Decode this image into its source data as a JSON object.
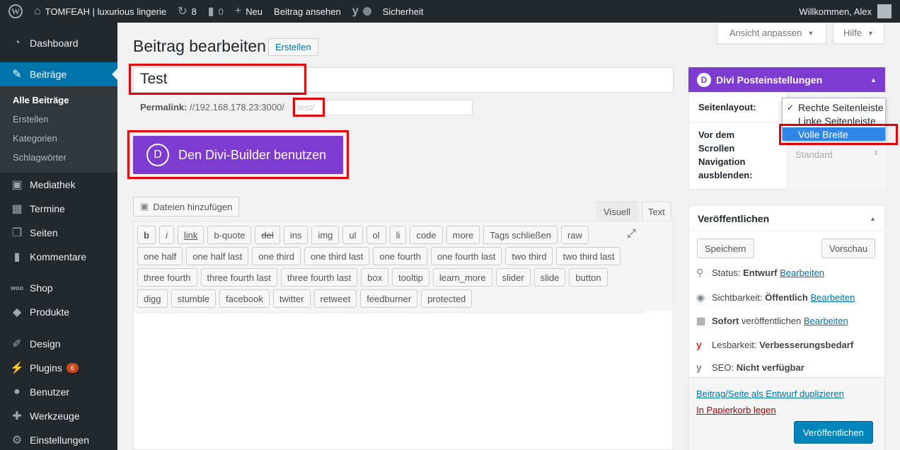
{
  "adminbar": {
    "site_name": "TOMFEAH | luxurious lingerie",
    "updates_count": "8",
    "comments_count": "0",
    "new_label": "Neu",
    "view_post_label": "Beitrag ansehen",
    "security_label": "Sicherheit",
    "welcome": "Willkommen, Alex"
  },
  "sidebar": {
    "items": [
      {
        "label": "Dashboard",
        "icon": "dashboard-icon"
      },
      {
        "label": "Beiträge",
        "icon": "pin-icon"
      },
      {
        "label": "Mediathek",
        "icon": "media-icon"
      },
      {
        "label": "Termine",
        "icon": "calendar-icon"
      },
      {
        "label": "Seiten",
        "icon": "pages-icon"
      },
      {
        "label": "Kommentare",
        "icon": "comment-icon"
      },
      {
        "label": "Shop",
        "icon": "woo-icon"
      },
      {
        "label": "Produkte",
        "icon": "products-icon"
      },
      {
        "label": "Design",
        "icon": "brush-icon"
      },
      {
        "label": "Plugins",
        "icon": "plugin-icon",
        "badge": "6"
      },
      {
        "label": "Benutzer",
        "icon": "user-icon"
      },
      {
        "label": "Werkzeuge",
        "icon": "wrench-icon"
      },
      {
        "label": "Einstellungen",
        "icon": "settings-icon"
      }
    ],
    "submenu": [
      "Alle Beiträge",
      "Erstellen",
      "Kategorien",
      "Schlagwörter"
    ]
  },
  "screen_options": {
    "label": "Ansicht anpassen",
    "help": "Hilfe"
  },
  "main": {
    "title": "Beitrag bearbeiten",
    "add_new": "Erstellen",
    "post_title": "Test",
    "permalink_label": "Permalink:",
    "permalink_url": "//192.168.178.23:3000/",
    "slug": "test/",
    "divi_button": "Den Divi-Builder benutzen",
    "media_button": "Dateien hinzufügen",
    "tab_visual": "Visuell",
    "tab_text": "Text",
    "quicktags": [
      "b",
      "i",
      "link",
      "b-quote",
      "del",
      "ins",
      "img",
      "ul",
      "ol",
      "li",
      "code",
      "more",
      "Tags schließen",
      "raw",
      "one half",
      "one half last",
      "one third",
      "one third last",
      "one fourth",
      "one fourth last",
      "two third",
      "two third last",
      "three fourth",
      "three fourth last",
      "three fourth last",
      "box",
      "tooltip",
      "learn_more",
      "slider",
      "slide",
      "button",
      "digg",
      "stumble",
      "facebook",
      "twitter",
      "retweet",
      "feedburner",
      "protected"
    ]
  },
  "divi_box": {
    "title": "Divi Posteinstellungen",
    "layout_label": "Seitenlayout:",
    "nav_label_1": "Vor dem",
    "nav_label_2": "Scrollen",
    "nav_label_3": "Navigation",
    "nav_label_4": "ausblenden:",
    "nav_value": "Standard",
    "layout_options": [
      "Rechte Seitenleiste",
      "Linke Seitenleiste",
      "Volle Breite"
    ]
  },
  "publish_box": {
    "title": "Veröffentlichen",
    "save": "Speichern",
    "preview": "Vorschau",
    "status_label": "Status:",
    "status_value": "Entwurf",
    "visibility_label": "Sichtbarkeit:",
    "visibility_value": "Öffentlich",
    "schedule_value": "Sofort",
    "schedule_label": "veröffentlichen",
    "readability_label": "Lesbarkeit:",
    "readability_value": "Verbesserungsbedarf",
    "seo_label": "SEO:",
    "seo_value": "Nicht verfügbar",
    "edit": "Bearbeiten",
    "duplicate": "Beitrag/Seite als Entwurf duplizieren",
    "trash": "In Papierkorb legen",
    "publish": "Veröffentlichen"
  },
  "colors": {
    "accent": "#0073aa",
    "divi": "#7e3bd0",
    "highlight": "#e0000b"
  }
}
